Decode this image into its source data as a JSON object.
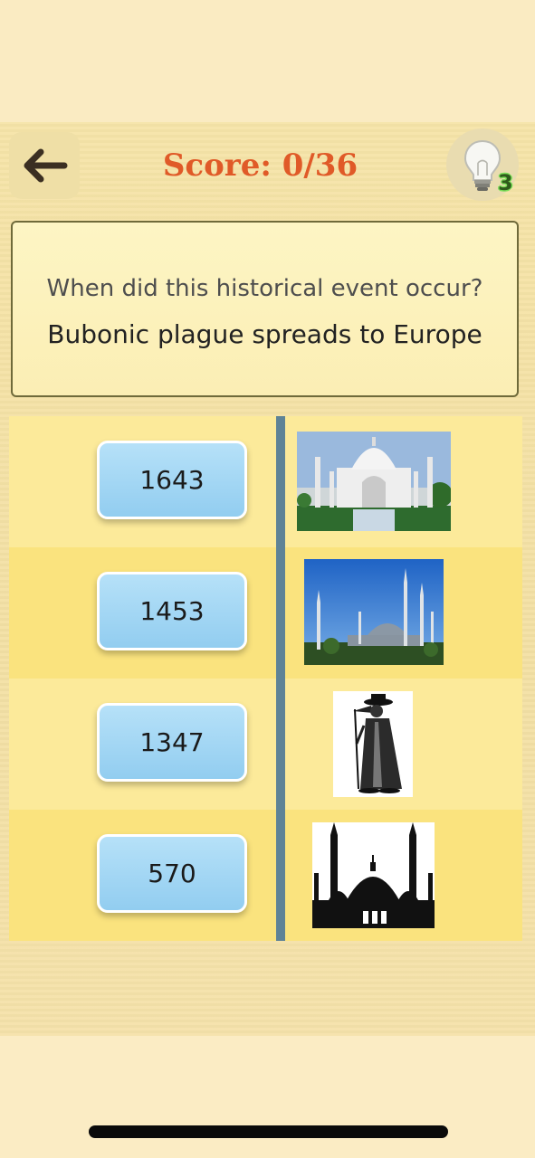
{
  "header": {
    "back_icon": "arrow-left-icon",
    "score_label": "Score: 0/36",
    "hint_icon": "lightbulb-icon",
    "hint_count": "3"
  },
  "question": {
    "prompt": "When did this historical event occur?",
    "event": "Bubonic plague spreads to Europe"
  },
  "rows": [
    {
      "year": "1643",
      "image": "taj-mahal-image"
    },
    {
      "year": "1453",
      "image": "blue-mosque-image"
    },
    {
      "year": "1347",
      "image": "plague-doctor-image"
    },
    {
      "year": "570",
      "image": "mosque-silhouette-image"
    }
  ],
  "colors": {
    "score": "#e05a28",
    "year_button": "#a7dbf6",
    "divider": "#5f8396",
    "row_light": "#fcea9a",
    "row_dark": "#fae37e"
  }
}
